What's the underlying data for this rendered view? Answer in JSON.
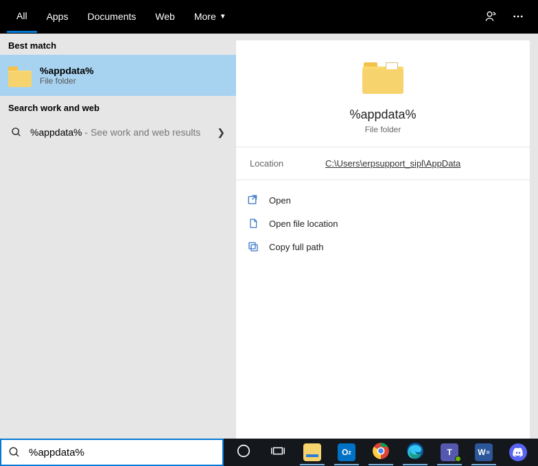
{
  "tabs": {
    "all": "All",
    "apps": "Apps",
    "documents": "Documents",
    "web": "Web",
    "more": "More"
  },
  "sections": {
    "best_match": "Best match",
    "search_web": "Search work and web"
  },
  "best_match": {
    "title": "%appdata%",
    "subtitle": "File folder"
  },
  "web_result": {
    "term": "%appdata%",
    "suffix": " - See work and web results"
  },
  "preview": {
    "title": "%appdata%",
    "subtitle": "File folder",
    "location_label": "Location",
    "location_path": "C:\\Users\\erpsupport_sipl\\AppData"
  },
  "actions": {
    "open": "Open",
    "open_location": "Open file location",
    "copy_path": "Copy full path"
  },
  "search": {
    "value": "%appdata%"
  },
  "taskbar": {
    "outlook": "O",
    "outlook_z": "z",
    "teams": "T",
    "word": "W",
    "word_e": "≡"
  }
}
